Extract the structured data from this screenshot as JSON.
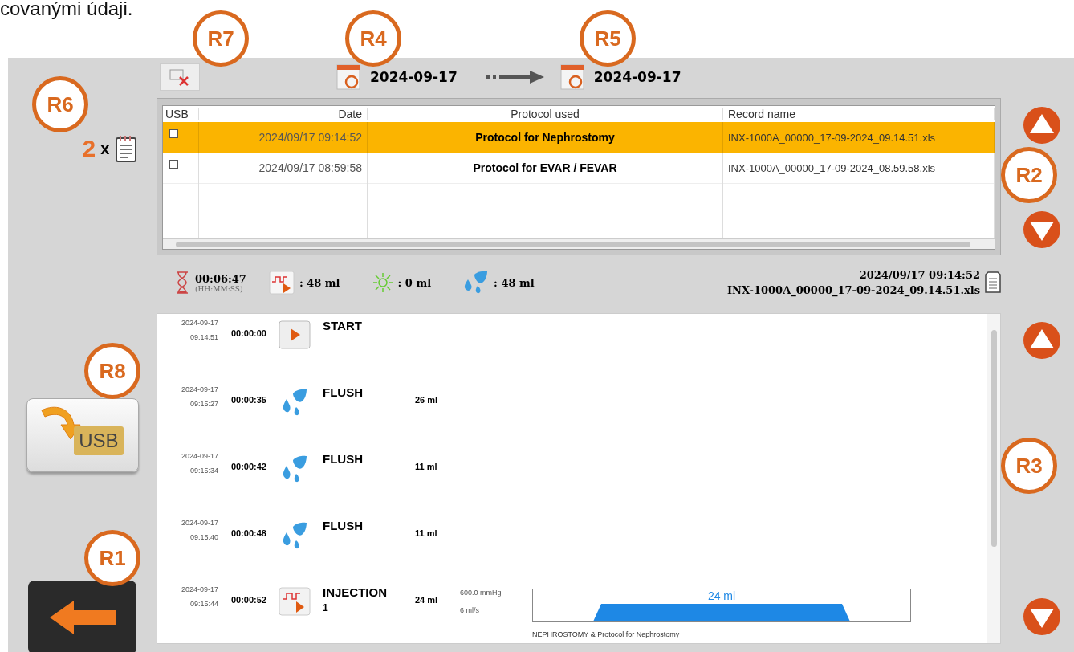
{
  "document_text": "covanými údaji.",
  "callouts": [
    {
      "label": "R7"
    },
    {
      "label": "R4"
    },
    {
      "label": "R5"
    },
    {
      "label": "R6"
    },
    {
      "label": "R2"
    },
    {
      "label": "R8"
    },
    {
      "label": "R3"
    },
    {
      "label": "R1"
    }
  ],
  "filter": {
    "from_date": "2024-09-17",
    "to_date": "2024-09-17"
  },
  "record_count": {
    "count": "2",
    "multiplier": "x"
  },
  "table": {
    "columns": [
      "USB",
      "Date",
      "Protocol used",
      "Record name"
    ],
    "rows": [
      {
        "usb_checked": false,
        "date": "2024/09/17 09:14:52",
        "protocol": "Protocol for Nephrostomy",
        "record_name": "INX-1000A_00000_17-09-2024_09.14.51.xls",
        "selected": true
      },
      {
        "usb_checked": false,
        "date": "2024/09/17 08:59:58",
        "protocol": "Protocol for EVAR / FEVAR",
        "record_name": "INX-1000A_00000_17-09-2024_08.59.58.xls",
        "selected": false
      }
    ]
  },
  "summary": {
    "duration": "00:06:47",
    "duration_unit": "(HH:MM:SS)",
    "injected": ": 48 ml",
    "light": ": 0 ml",
    "flush": ": 48 ml",
    "date": "2024/09/17 09:14:52",
    "record_name": "INX-1000A_00000_17-09-2024_09.14.51.xls"
  },
  "events": [
    {
      "kind": "start",
      "date": "2024-09-17",
      "time": "09:14:51",
      "elapsed": "00:00:00",
      "name": "START"
    },
    {
      "kind": "flush",
      "date": "2024-09-17",
      "time": "09:15:27",
      "elapsed": "00:00:35",
      "name": "FLUSH",
      "volume": "26 ml"
    },
    {
      "kind": "flush",
      "date": "2024-09-17",
      "time": "09:15:34",
      "elapsed": "00:00:42",
      "name": "FLUSH",
      "volume": "11 ml"
    },
    {
      "kind": "flush",
      "date": "2024-09-17",
      "time": "09:15:40",
      "elapsed": "00:00:48",
      "name": "FLUSH",
      "volume": "11 ml"
    },
    {
      "kind": "injection",
      "date": "2024-09-17",
      "time": "09:15:44",
      "elapsed": "00:00:52",
      "name": "INJECTION",
      "number": "1",
      "volume": "24 ml",
      "pressure": "600.0 mmHg",
      "rate": "6 ml/s",
      "profile_label": "24 ml",
      "caption": "NEPHROSTOMY & Protocol for Nephrostomy"
    }
  ],
  "usb_button": {
    "label": "USB"
  }
}
